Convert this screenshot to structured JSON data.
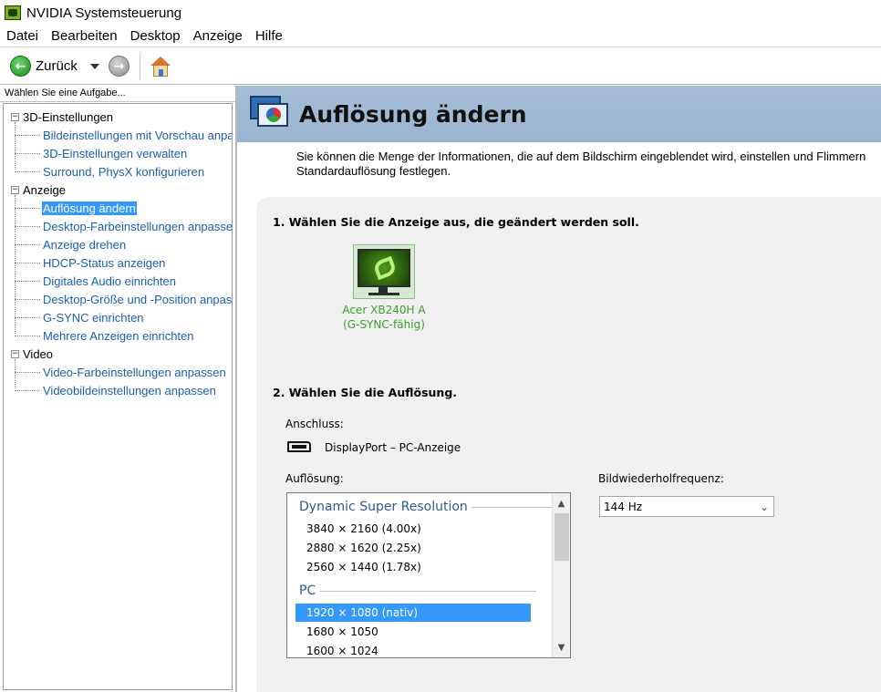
{
  "window": {
    "title": "NVIDIA Systemsteuerung"
  },
  "menu": [
    "Datei",
    "Bearbeiten",
    "Desktop",
    "Anzeige",
    "Hilfe"
  ],
  "toolbar": {
    "back_label": "Zurück"
  },
  "sidebar": {
    "header": "Wählen Sie eine Aufgabe...",
    "groups": [
      {
        "label": "3D-Einstellungen",
        "items": [
          "Bildeinstellungen mit Vorschau anpa",
          "3D-Einstellungen verwalten",
          "Surround, PhysX konfigurieren"
        ]
      },
      {
        "label": "Anzeige",
        "items": [
          "Auflösung ändern",
          "Desktop-Farbeinstellungen anpassen",
          "Anzeige drehen",
          "HDCP-Status anzeigen",
          "Digitales Audio einrichten",
          "Desktop-Größe und -Position anpass",
          "G-SYNC einrichten",
          "Mehrere Anzeigen einrichten"
        ]
      },
      {
        "label": "Video",
        "items": [
          "Video-Farbeinstellungen anpassen",
          "Videobildeinstellungen anpassen"
        ]
      }
    ],
    "selected_item": "Auflösung ändern"
  },
  "page": {
    "title": "Auflösung ändern",
    "description_line1": "Sie können die Menge der Informationen, die auf dem Bildschirm eingeblendet wird, einstellen und Flimmern",
    "description_line2": "Standardauflösung festlegen.",
    "step1": "1. Wählen Sie die Anzeige aus, die geändert werden soll.",
    "display_name": "Acer XB240H A",
    "display_sub": "(G-SYNC-fähig)",
    "step2": "2. Wählen Sie die Auflösung.",
    "connector_label": "Anschluss:",
    "connector_value": "DisplayPort – PC-Anzeige",
    "resolution_label": "Auflösung:",
    "refresh_label": "Bildwiederholfrequenz:",
    "refresh_value": "144 Hz",
    "resolution_groups": [
      {
        "name": "Dynamic Super Resolution",
        "items": [
          "3840 × 2160 (4.00x)",
          "2880 × 1620 (2.25x)",
          "2560 × 1440 (1.78x)"
        ]
      },
      {
        "name": "PC",
        "items": [
          "1920 × 1080 (nativ)",
          "1680 × 1050",
          "1600 × 1024"
        ]
      }
    ],
    "selected_resolution": "1920 × 1080 (nativ)"
  }
}
